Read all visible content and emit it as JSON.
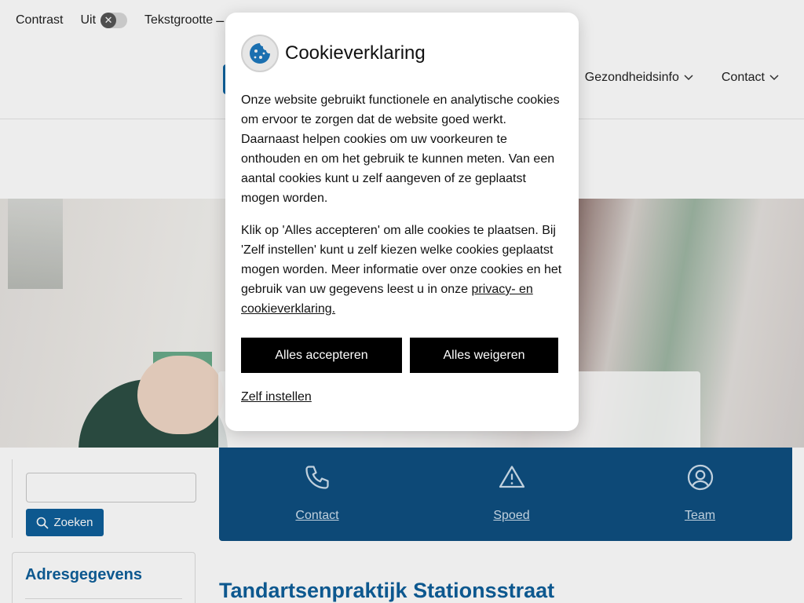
{
  "a11y": {
    "contrast_label": "Contrast",
    "contrast_state": "Uit",
    "textsize_label": "Tekstgrootte",
    "textsize_dash": "–"
  },
  "nav": {
    "items": [
      {
        "label": "Gezondheidsinfo"
      },
      {
        "label": "Contact"
      }
    ]
  },
  "quick_links": [
    {
      "label": "Contact",
      "icon": "phone-icon"
    },
    {
      "label": "Spoed",
      "icon": "warning-icon"
    },
    {
      "label": "Team",
      "icon": "user-icon"
    }
  ],
  "search": {
    "button_label": "Zoeken",
    "value": ""
  },
  "sidebar": {
    "address_title": "Adresgegevens"
  },
  "page": {
    "title": "Tandartsenpraktijk Stationsstraat"
  },
  "cookie_modal": {
    "title": "Cookieverklaring",
    "paragraph1": "Onze website gebruikt functionele en analytische cookies om ervoor te zorgen dat de website goed werkt. Daarnaast helpen cookies om uw voorkeuren te onthouden en om het gebruik te kunnen meten. Van een aantal cookies kunt u zelf aangeven of ze geplaatst mogen worden.",
    "paragraph2_text": "Klik op 'Alles accepteren' om alle cookies te plaatsen. Bij 'Zelf instellen' kunt u zelf kiezen welke cookies geplaatst mogen worden. Meer informatie over onze cookies en het gebruik van uw gegevens leest u in onze ",
    "paragraph2_link": "privacy- en cookieverklaring.",
    "accept_label": "Alles accepteren",
    "reject_label": "Alles weigeren",
    "custom_label": "Zelf instellen"
  },
  "colors": {
    "brand_blue": "#0e5f9a",
    "band_blue": "#0e4f80",
    "button_black": "#000000"
  }
}
